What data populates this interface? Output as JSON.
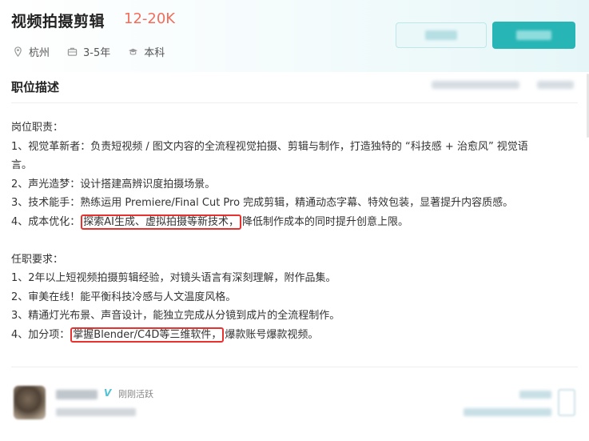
{
  "job": {
    "title": "视频拍摄剪辑",
    "salary": "12-20K",
    "location": "杭州",
    "experience": "3-5年",
    "education": "本科",
    "location_icon": "location-pin-icon",
    "experience_icon": "briefcase-icon",
    "education_icon": "graduation-cap-icon"
  },
  "section": {
    "title": "职位描述"
  },
  "description": {
    "duties_header": "岗位职责：",
    "duty_1": "1、视觉革新者：负责短视频 / 图文内容的全流程视觉拍摄、剪辑与制作，打造独特的 “科技感 + 治愈风” 视觉语",
    "duty_1_cont": "言。",
    "duty_2": "2、声光造梦：设计搭建高辨识度拍摄场景。",
    "duty_3": "3、技术能手：熟练运用 Premiere/Final Cut Pro 完成剪辑，精通动态字幕、特效包装，显著提升内容质感。",
    "duty_4_prefix": "4、成本优化：",
    "duty_4_highlight": "探索AI生成、虚拟拍摄等新技术，",
    "duty_4_suffix": "降低制作成本的同时提升创意上限。",
    "req_header": "任职要求：",
    "req_1": "1、2年以上短视频拍摄剪辑经验，对镜头语言有深刻理解，附作品集。",
    "req_2": "2、审美在线！能平衡科技冷感与人文温度风格。",
    "req_3": "3、精通灯光布景、声音设计，能独立完成从分镜到成片的全流程制作。",
    "req_4_prefix": "4、加分项：",
    "req_4_highlight": "掌握Blender/C4D等三维软件，",
    "req_4_suffix": "爆款账号爆款视频。"
  },
  "recruiter": {
    "verified_badge": "V",
    "status": "刚刚活跃"
  },
  "colors": {
    "salary": "#f26d5b",
    "primary_button": "#27b5b6",
    "highlight_border": "#e8322f",
    "verified": "#4fc3d4"
  }
}
